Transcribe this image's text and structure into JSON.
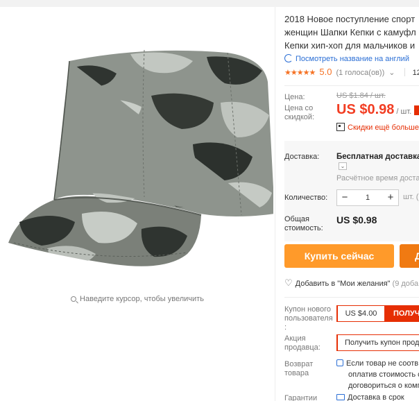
{
  "product": {
    "title_lines": [
      "2018 Новое поступление спорт",
      "женщин Шапки Кепки с камуфл",
      "Кепки хип-хоп для мальчиков и"
    ],
    "translate_link": "Посмотреть название на англий",
    "rating": {
      "stars": "★★★★★",
      "score": "5.0",
      "votes": "(1 голоса(ов))",
      "chevron": "⌄",
      "orders": "12"
    }
  },
  "gallery": {
    "zoom_hint": "Наведите курсор, чтобы увеличить"
  },
  "price": {
    "label": "Цена:",
    "old": "US $1.84 / шт.",
    "discount_label_line1": "Цена со",
    "discount_label_line2": "скидкой:",
    "new_amount": "US $0.98",
    "new_unit": "/ шт.",
    "app_discount": "Скидки ещё больше",
    "accent": "#f23d22"
  },
  "shipping": {
    "label": "Доставка:",
    "value": "Бесплатная доставка в",
    "dropdown_icon": "⌄",
    "eta": "Расчётное время достав"
  },
  "quantity": {
    "label": "Количество:",
    "minus": "−",
    "plus": "+",
    "value": "1",
    "unit": "шт. ("
  },
  "total": {
    "label_line1": "Общая",
    "label_line2": "стоимость:",
    "value": "US $0.98"
  },
  "actions": {
    "buy_now": "Купить сейчас",
    "add_to_cart": "Д",
    "buy_color": "#ff9a2a",
    "cart_color": "#f07a12",
    "wishlist_icon": "♡",
    "wishlist": "Добавить в \"Мои желания\"",
    "wishlist_count": "(9 доба"
  },
  "coupons": {
    "new_user_label_line1": "Купон нового",
    "new_user_label_line2": "пользователя",
    "new_user_label_line3": ":",
    "new_user_value": "US $4.00",
    "new_user_get": "ПОЛУЧ",
    "seller_label_line1": "Акция",
    "seller_label_line2": "продавца:",
    "seller_get": "Получить купон прод"
  },
  "returns": {
    "label_line1": "Возврат",
    "label_line2": "товара",
    "line1": "Если товар не соотв",
    "line2": "оплатив стоимость с",
    "line3": "договориться о комп"
  },
  "guarantee": {
    "label": "Гарантии",
    "value": "Доставка в срок"
  }
}
